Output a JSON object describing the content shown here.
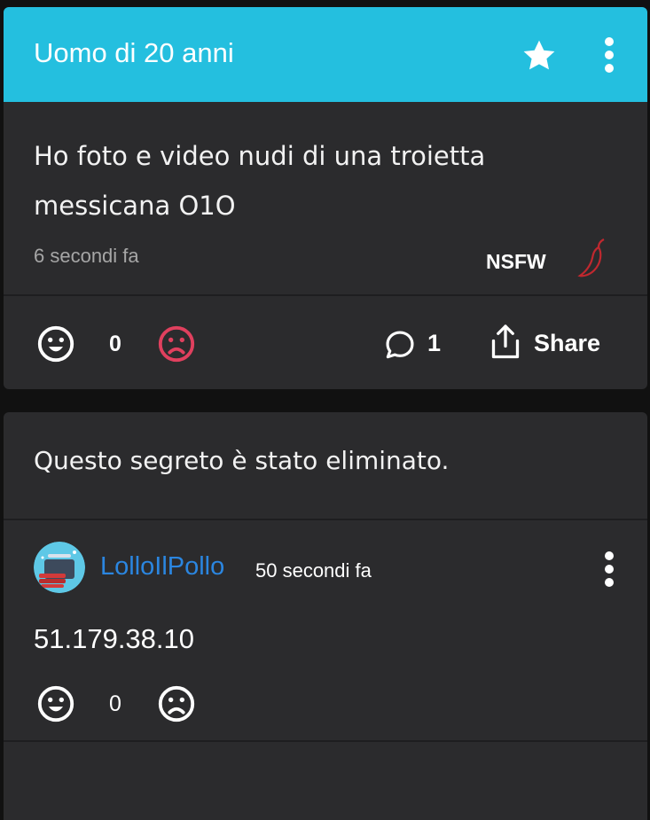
{
  "post": {
    "title": "Uomo di 20 anni",
    "text": "Ho foto e video nudi di una troietta messicana O1O",
    "time": "6 secondi fa",
    "tag": "NSFW",
    "score": "0",
    "comment_count": "1",
    "share_label": "Share"
  },
  "deleted_post": {
    "message": "Questo segreto è stato eliminato.",
    "comment": {
      "username": "LolloIlPollo",
      "time": "50 secondi fa",
      "text": "51.179.38.10",
      "score": "0"
    }
  },
  "colors": {
    "header": "#24bfdf",
    "card": "#2b2b2d",
    "background": "#111111",
    "downvote_active": "#e0405e",
    "username": "#2b86e0",
    "chili": "#c0282f"
  },
  "icons": {
    "star": "star-icon",
    "menu": "kebab-menu-icon",
    "upvote": "smile-icon",
    "downvote": "frown-icon",
    "comment": "comment-bubble-icon",
    "share": "share-icon",
    "nsfw": "chili-pepper-icon"
  }
}
